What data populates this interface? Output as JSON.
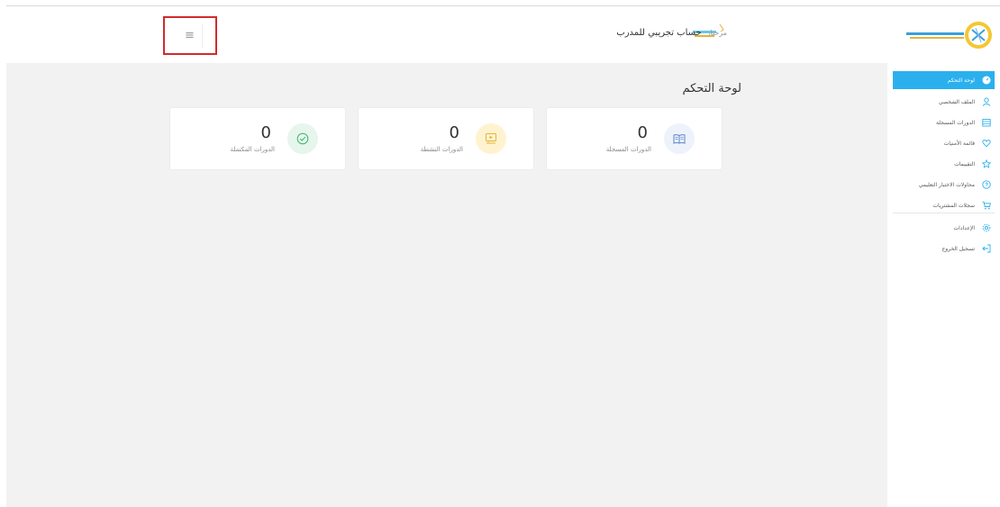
{
  "header": {
    "greeting_hello": "مرحبا،",
    "greeting_name": "حساب تجريبي للمدرب",
    "menu_icon": "hamburger-icon"
  },
  "page": {
    "title": "لوحة التحكم"
  },
  "cards": [
    {
      "count": "0",
      "label": "الدورات المسجلة",
      "icon": "book-icon",
      "color": "#5b86c9",
      "bg": "#eef2fb"
    },
    {
      "count": "0",
      "label": "الدورات النشطة",
      "icon": "video-icon",
      "color": "#e3b33a",
      "bg": "#fff3cf"
    },
    {
      "count": "0",
      "label": "الدورات المكتملة",
      "icon": "check-circle-icon",
      "color": "#39b36b",
      "bg": "#e6f6ec"
    }
  ],
  "sidebar": {
    "items": [
      {
        "label": "لوحة التحكم",
        "icon": "dashboard-icon",
        "active": true
      },
      {
        "label": "الملف الشخصي",
        "icon": "user-icon"
      },
      {
        "label": "الدورات المسجلة",
        "icon": "calendar-icon"
      },
      {
        "label": "قائمة الأمنيات",
        "icon": "heart-icon"
      },
      {
        "label": "التقييمات",
        "icon": "star-icon"
      },
      {
        "label": "محاولات الاختبار التعليمي",
        "icon": "quiz-icon"
      },
      {
        "label": "سجلات المشتريات",
        "icon": "cart-icon"
      },
      {
        "label": "الإعدادات",
        "icon": "gear-icon"
      },
      {
        "label": "تسجيل الخروج",
        "icon": "logout-icon"
      }
    ]
  },
  "colors": {
    "accent": "#2bb0ee",
    "highlight": "#d02c2c",
    "icon": "#2bb0ee"
  }
}
